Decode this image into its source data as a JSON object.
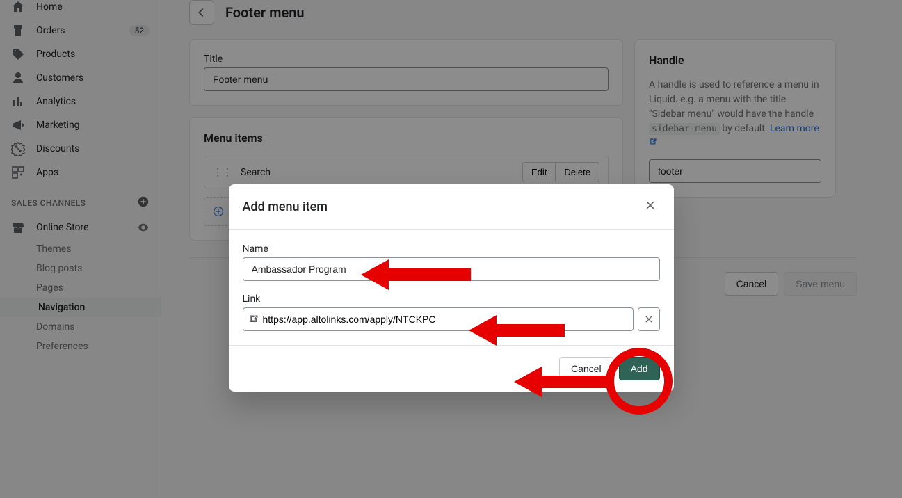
{
  "sidebar": {
    "items": [
      {
        "label": "Home",
        "icon": "home"
      },
      {
        "label": "Orders",
        "icon": "orders",
        "badge": "52"
      },
      {
        "label": "Products",
        "icon": "tag"
      },
      {
        "label": "Customers",
        "icon": "person"
      },
      {
        "label": "Analytics",
        "icon": "bars"
      },
      {
        "label": "Marketing",
        "icon": "megaphone"
      },
      {
        "label": "Discounts",
        "icon": "discount"
      },
      {
        "label": "Apps",
        "icon": "apps"
      }
    ],
    "section_title": "SALES CHANNELS",
    "channel": {
      "label": "Online Store",
      "icon": "store"
    },
    "sub_items": [
      {
        "label": "Themes"
      },
      {
        "label": "Blog posts"
      },
      {
        "label": "Pages"
      },
      {
        "label": "Navigation",
        "active": true
      },
      {
        "label": "Domains"
      },
      {
        "label": "Preferences"
      }
    ]
  },
  "page": {
    "title": "Footer menu",
    "title_card": {
      "label": "Title",
      "value": "Footer menu"
    },
    "menu_items_title": "Menu items",
    "menu_rows": [
      {
        "label": "Search",
        "edit": "Edit",
        "delete": "Delete"
      }
    ],
    "add_item_label": "Add menu item",
    "footer": {
      "cancel": "Cancel",
      "save": "Save menu"
    },
    "handle_card": {
      "title": "Handle",
      "desc_pre": "A handle is used to reference a menu in Liquid. e.g. a menu with the title \"Sidebar menu\" would have the handle ",
      "desc_code": "sidebar-menu",
      "desc_post": " by default. ",
      "learn_more": "Learn more",
      "value": "footer"
    }
  },
  "modal": {
    "title": "Add menu item",
    "name_label": "Name",
    "name_value": "Ambassador Program",
    "link_label": "Link",
    "link_value": "https://app.altolinks.com/apply/NTCKPC",
    "cancel": "Cancel",
    "add": "Add"
  }
}
